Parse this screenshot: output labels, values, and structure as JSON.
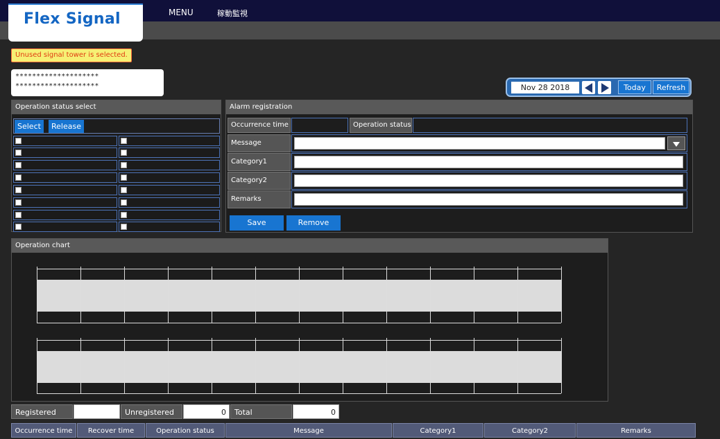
{
  "header": {
    "logo_text": "Flex Signal",
    "menu_label": "MENU",
    "page_label": "稼動監視"
  },
  "warning_text": "Unused signal tower is selected.",
  "masked_lines": [
    "********************",
    "********************"
  ],
  "date_nav": {
    "date": "Nov 28 2018",
    "today_label": "Today",
    "refresh_label": "Refresh"
  },
  "ops_select": {
    "title": "Operation status select",
    "select_label": "Select",
    "release_label": "Release"
  },
  "alarm": {
    "title": "Alarm registration",
    "occurrence_time_label": "Occurrence time",
    "operation_status_label": "Operation status",
    "message_label": "Message",
    "category1_label": "Category1",
    "category2_label": "Category2",
    "remarks_label": "Remarks",
    "save_label": "Save",
    "remove_label": "Remove"
  },
  "chart": {
    "title": "Operation chart"
  },
  "summary": {
    "registered_label": "Registered",
    "registered_value": "",
    "unregistered_label": "Unregistered",
    "unregistered_value": "0",
    "total_label": "Total",
    "total_value": "0"
  },
  "table": {
    "columns": [
      "Occurrence time",
      "Recover time",
      "Operation status",
      "Message",
      "Category1",
      "Category2",
      "Remarks"
    ]
  },
  "colors": {
    "accent": "#1875d1",
    "warning_bg": "#f6f074",
    "warning_text": "#e03c12"
  }
}
